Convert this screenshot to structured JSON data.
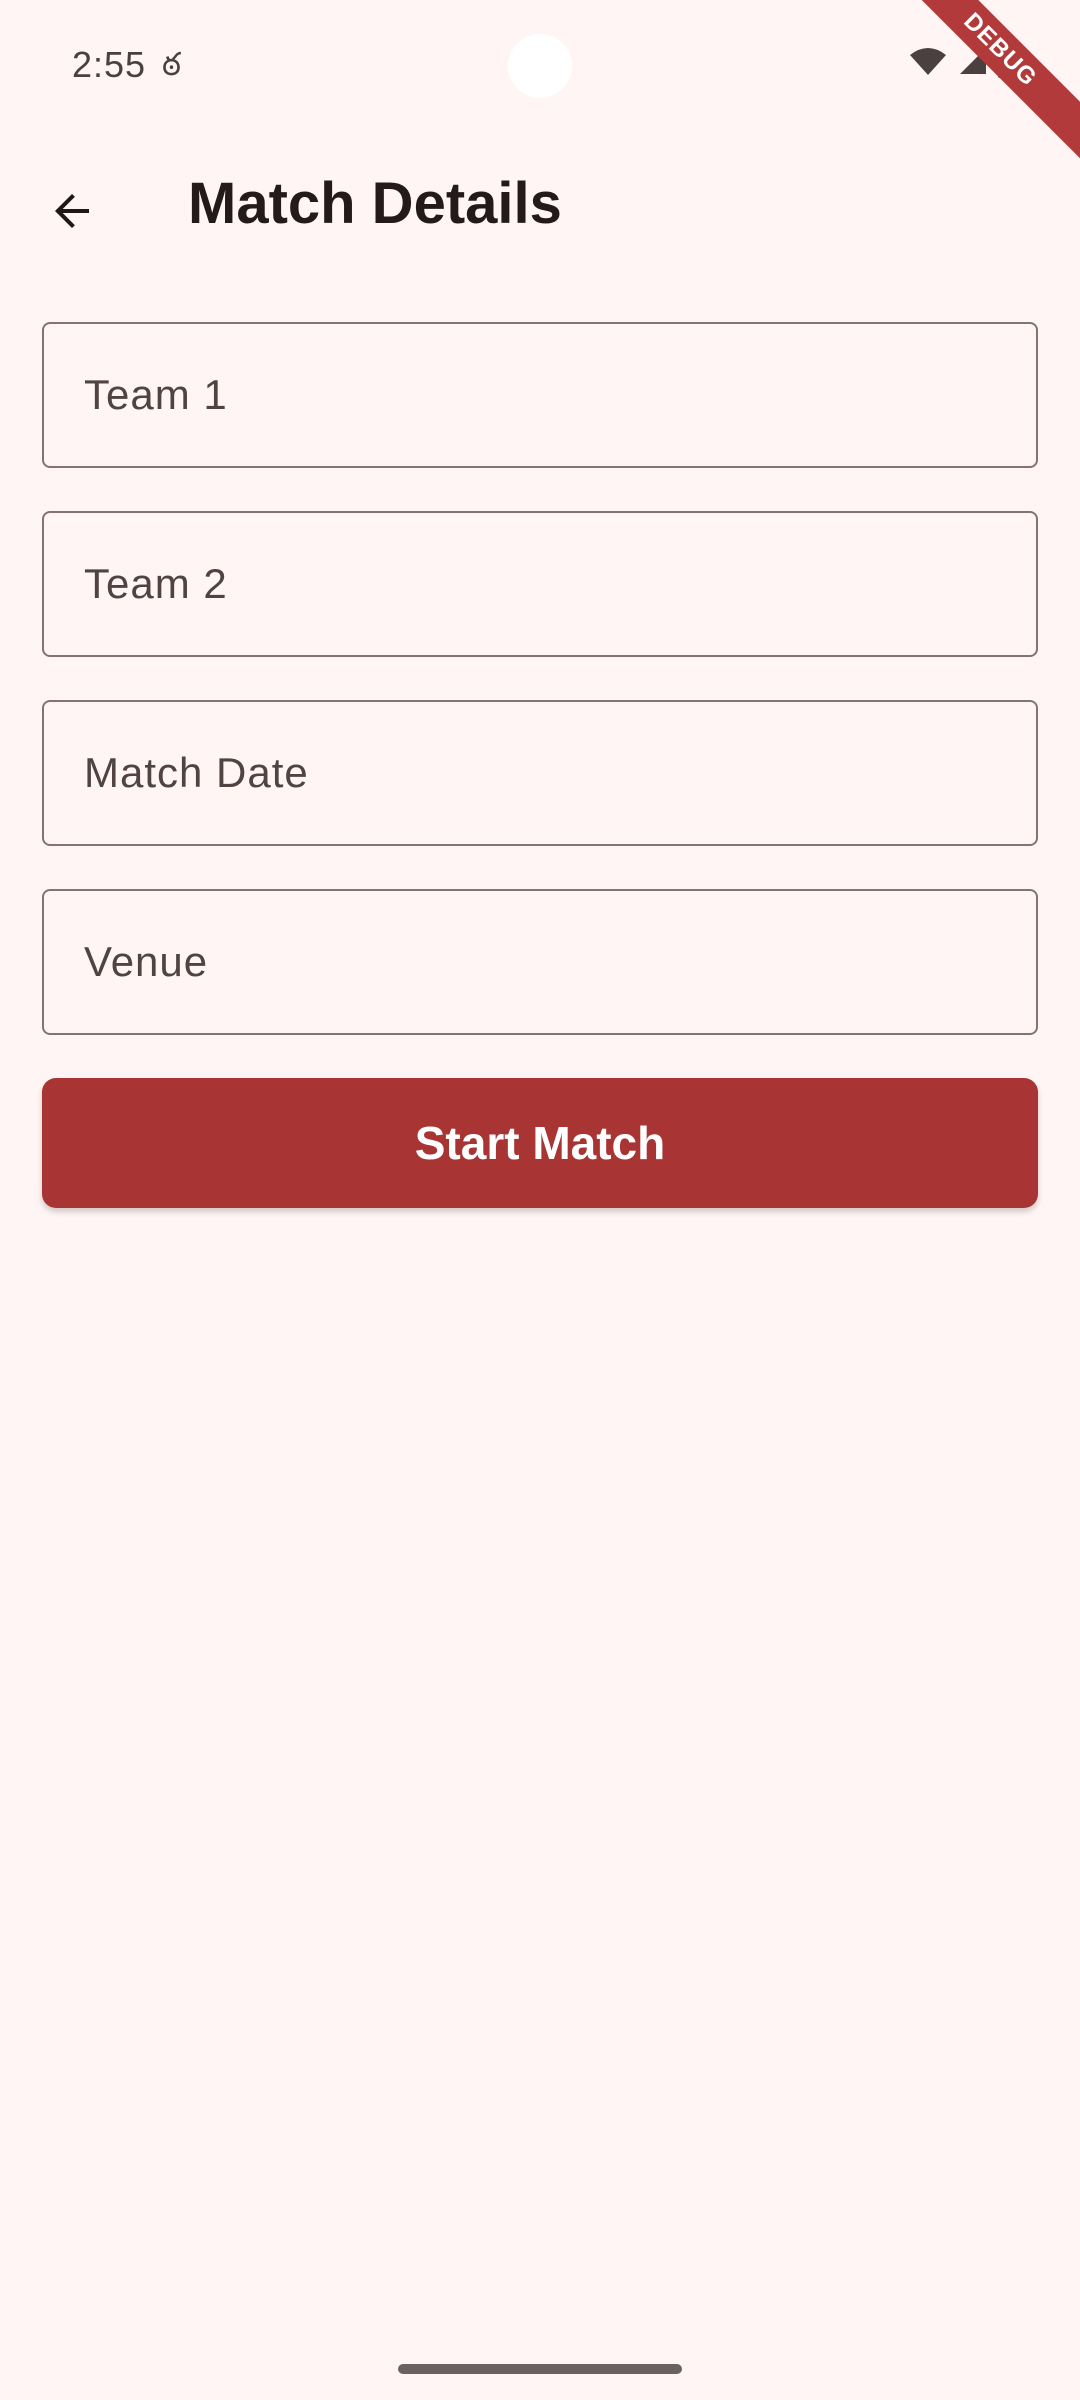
{
  "status_bar": {
    "time": "2:55",
    "notification_glyph": "ఠ"
  },
  "debug_banner": {
    "label": "DEBUG"
  },
  "app_bar": {
    "title": "Match Details"
  },
  "form": {
    "fields": [
      {
        "label": "Team 1",
        "value": ""
      },
      {
        "label": "Team 2",
        "value": ""
      },
      {
        "label": "Match Date",
        "value": ""
      },
      {
        "label": "Venue",
        "value": ""
      }
    ],
    "submit_label": "Start Match"
  },
  "colors": {
    "background": "#FFF5F4",
    "primary": "#A83534",
    "outline": "#857373",
    "title_text": "#241A1A"
  },
  "icons": {
    "back": "arrow-back-icon",
    "wifi": "wifi-icon",
    "signal": "signal-icon",
    "battery": "battery-icon"
  }
}
